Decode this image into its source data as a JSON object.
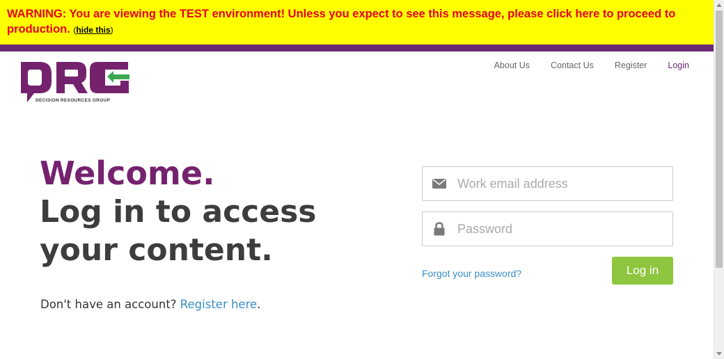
{
  "warning": {
    "message": "WARNING: You are viewing the TEST environment! Unless you expect to see this message, please click here to proceed to production.",
    "hide_open": "(",
    "hide_label": "hide this",
    "hide_close": ")"
  },
  "logo": {
    "tagline": "DECISION RESOURCES GROUP"
  },
  "nav": {
    "items": [
      {
        "label": "About Us"
      },
      {
        "label": "Contact Us"
      },
      {
        "label": "Register"
      },
      {
        "label": "Login"
      }
    ]
  },
  "hero": {
    "welcome": "Welcome.",
    "line1": "Log in to access",
    "line2": "your content."
  },
  "register": {
    "prompt": "Don't have an account? ",
    "link": "Register here",
    "suffix": "."
  },
  "form": {
    "email_placeholder": "Work email address",
    "email_value": "",
    "password_placeholder": "Password",
    "password_value": "",
    "forgot_label": "Forgot your password?",
    "login_label": "Log in"
  },
  "colors": {
    "warning_bg": "#ffff00",
    "warning_text": "#e8001c",
    "brand_purple": "#75226e",
    "link_blue": "#3a8dc5",
    "button_green": "#8ec63f"
  },
  "icons": {
    "email": "envelope-icon",
    "password": "lock-icon"
  }
}
